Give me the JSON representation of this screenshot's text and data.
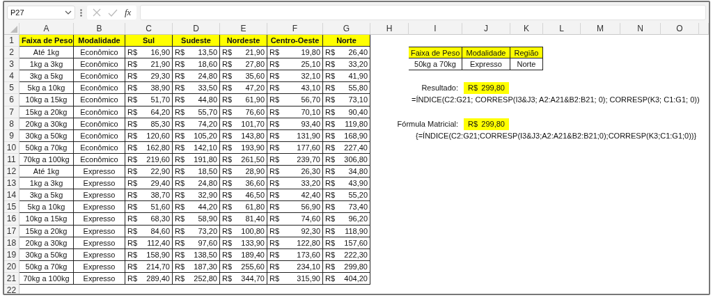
{
  "name_box": "P27",
  "formula_bar": {
    "fx_label": "fx"
  },
  "columns": [
    "A",
    "B",
    "C",
    "D",
    "E",
    "F",
    "G",
    "H",
    "I",
    "J",
    "K",
    "L",
    "M",
    "N",
    "O"
  ],
  "row_numbers": [
    "1",
    "2",
    "3",
    "4",
    "5",
    "6",
    "7",
    "8",
    "9",
    "10",
    "11",
    "12",
    "13",
    "14",
    "15",
    "16",
    "17",
    "18",
    "19",
    "20",
    "21",
    "22"
  ],
  "price_table": {
    "headers": [
      "Faixa de Peso",
      "Modalidade",
      "Sul",
      "Sudeste",
      "Nordeste",
      "Centro-Oeste",
      "Norte"
    ],
    "rows": [
      {
        "faixa": "Até 1kg",
        "modalidade": "Econômico",
        "prices": [
          {
            "currency": "R$",
            "amount": "16,90"
          },
          {
            "currency": "R$",
            "amount": "13,50"
          },
          {
            "currency": "R$",
            "amount": "21,90"
          },
          {
            "currency": "R$",
            "amount": "19,80"
          },
          {
            "currency": "R$",
            "amount": "26,40"
          }
        ]
      },
      {
        "faixa": "1kg a 3kg",
        "modalidade": "Econômico",
        "prices": [
          {
            "currency": "R$",
            "amount": "21,90"
          },
          {
            "currency": "R$",
            "amount": "18,60"
          },
          {
            "currency": "R$",
            "amount": "27,80"
          },
          {
            "currency": "R$",
            "amount": "25,10"
          },
          {
            "currency": "R$",
            "amount": "33,20"
          }
        ]
      },
      {
        "faixa": "3kg a 5kg",
        "modalidade": "Econômico",
        "prices": [
          {
            "currency": "R$",
            "amount": "29,30"
          },
          {
            "currency": "R$",
            "amount": "24,80"
          },
          {
            "currency": "R$",
            "amount": "35,60"
          },
          {
            "currency": "R$",
            "amount": "32,10"
          },
          {
            "currency": "R$",
            "amount": "41,90"
          }
        ]
      },
      {
        "faixa": "5kg a 10kg",
        "modalidade": "Econômico",
        "prices": [
          {
            "currency": "R$",
            "amount": "38,90"
          },
          {
            "currency": "R$",
            "amount": "33,50"
          },
          {
            "currency": "R$",
            "amount": "47,20"
          },
          {
            "currency": "R$",
            "amount": "43,10"
          },
          {
            "currency": "R$",
            "amount": "55,80"
          }
        ]
      },
      {
        "faixa": "10kg a 15kg",
        "modalidade": "Econômico",
        "prices": [
          {
            "currency": "R$",
            "amount": "51,70"
          },
          {
            "currency": "R$",
            "amount": "44,80"
          },
          {
            "currency": "R$",
            "amount": "61,90"
          },
          {
            "currency": "R$",
            "amount": "56,70"
          },
          {
            "currency": "R$",
            "amount": "73,10"
          }
        ]
      },
      {
        "faixa": "15kg a 20kg",
        "modalidade": "Econômico",
        "prices": [
          {
            "currency": "R$",
            "amount": "64,20"
          },
          {
            "currency": "R$",
            "amount": "55,70"
          },
          {
            "currency": "R$",
            "amount": "76,60"
          },
          {
            "currency": "R$",
            "amount": "70,10"
          },
          {
            "currency": "R$",
            "amount": "90,40"
          }
        ]
      },
      {
        "faixa": "20kg a 30kg",
        "modalidade": "Econômico",
        "prices": [
          {
            "currency": "R$",
            "amount": "85,30"
          },
          {
            "currency": "R$",
            "amount": "74,20"
          },
          {
            "currency": "R$",
            "amount": "101,70"
          },
          {
            "currency": "R$",
            "amount": "93,40"
          },
          {
            "currency": "R$",
            "amount": "119,80"
          }
        ]
      },
      {
        "faixa": "30kg a 50kg",
        "modalidade": "Econômico",
        "prices": [
          {
            "currency": "R$",
            "amount": "120,60"
          },
          {
            "currency": "R$",
            "amount": "105,20"
          },
          {
            "currency": "R$",
            "amount": "143,80"
          },
          {
            "currency": "R$",
            "amount": "131,90"
          },
          {
            "currency": "R$",
            "amount": "168,90"
          }
        ]
      },
      {
        "faixa": "50kg a 70kg",
        "modalidade": "Econômico",
        "prices": [
          {
            "currency": "R$",
            "amount": "162,80"
          },
          {
            "currency": "R$",
            "amount": "142,10"
          },
          {
            "currency": "R$",
            "amount": "193,90"
          },
          {
            "currency": "R$",
            "amount": "177,60"
          },
          {
            "currency": "R$",
            "amount": "227,40"
          }
        ]
      },
      {
        "faixa": "70kg a 100kg",
        "modalidade": "Econômico",
        "prices": [
          {
            "currency": "R$",
            "amount": "219,60"
          },
          {
            "currency": "R$",
            "amount": "191,80"
          },
          {
            "currency": "R$",
            "amount": "261,50"
          },
          {
            "currency": "R$",
            "amount": "239,70"
          },
          {
            "currency": "R$",
            "amount": "306,80"
          }
        ]
      },
      {
        "faixa": "Até 1kg",
        "modalidade": "Expresso",
        "prices": [
          {
            "currency": "R$",
            "amount": "22,90"
          },
          {
            "currency": "R$",
            "amount": "18,50"
          },
          {
            "currency": "R$",
            "amount": "28,90"
          },
          {
            "currency": "R$",
            "amount": "26,30"
          },
          {
            "currency": "R$",
            "amount": "34,80"
          }
        ]
      },
      {
        "faixa": "1kg a 3kg",
        "modalidade": "Expresso",
        "prices": [
          {
            "currency": "R$",
            "amount": "29,40"
          },
          {
            "currency": "R$",
            "amount": "24,80"
          },
          {
            "currency": "R$",
            "amount": "36,60"
          },
          {
            "currency": "R$",
            "amount": "33,20"
          },
          {
            "currency": "R$",
            "amount": "43,90"
          }
        ]
      },
      {
        "faixa": "3kg a 5kg",
        "modalidade": "Expresso",
        "prices": [
          {
            "currency": "R$",
            "amount": "38,70"
          },
          {
            "currency": "R$",
            "amount": "32,90"
          },
          {
            "currency": "R$",
            "amount": "46,50"
          },
          {
            "currency": "R$",
            "amount": "42,40"
          },
          {
            "currency": "R$",
            "amount": "55,20"
          }
        ]
      },
      {
        "faixa": "5kg a 10kg",
        "modalidade": "Expresso",
        "prices": [
          {
            "currency": "R$",
            "amount": "51,60"
          },
          {
            "currency": "R$",
            "amount": "44,20"
          },
          {
            "currency": "R$",
            "amount": "61,80"
          },
          {
            "currency": "R$",
            "amount": "56,90"
          },
          {
            "currency": "R$",
            "amount": "73,40"
          }
        ]
      },
      {
        "faixa": "10kg a 15kg",
        "modalidade": "Expresso",
        "prices": [
          {
            "currency": "R$",
            "amount": "68,30"
          },
          {
            "currency": "R$",
            "amount": "58,90"
          },
          {
            "currency": "R$",
            "amount": "81,40"
          },
          {
            "currency": "R$",
            "amount": "74,60"
          },
          {
            "currency": "R$",
            "amount": "96,20"
          }
        ]
      },
      {
        "faixa": "15kg a 20kg",
        "modalidade": "Expresso",
        "prices": [
          {
            "currency": "R$",
            "amount": "84,60"
          },
          {
            "currency": "R$",
            "amount": "73,20"
          },
          {
            "currency": "R$",
            "amount": "100,80"
          },
          {
            "currency": "R$",
            "amount": "92,30"
          },
          {
            "currency": "R$",
            "amount": "118,90"
          }
        ]
      },
      {
        "faixa": "20kg a 30kg",
        "modalidade": "Expresso",
        "prices": [
          {
            "currency": "R$",
            "amount": "112,40"
          },
          {
            "currency": "R$",
            "amount": "97,60"
          },
          {
            "currency": "R$",
            "amount": "133,90"
          },
          {
            "currency": "R$",
            "amount": "122,80"
          },
          {
            "currency": "R$",
            "amount": "157,60"
          }
        ]
      },
      {
        "faixa": "30kg a 50kg",
        "modalidade": "Expresso",
        "prices": [
          {
            "currency": "R$",
            "amount": "158,90"
          },
          {
            "currency": "R$",
            "amount": "138,50"
          },
          {
            "currency": "R$",
            "amount": "189,40"
          },
          {
            "currency": "R$",
            "amount": "173,60"
          },
          {
            "currency": "R$",
            "amount": "222,30"
          }
        ]
      },
      {
        "faixa": "50kg a 70kg",
        "modalidade": "Expresso",
        "prices": [
          {
            "currency": "R$",
            "amount": "214,70"
          },
          {
            "currency": "R$",
            "amount": "187,30"
          },
          {
            "currency": "R$",
            "amount": "255,60"
          },
          {
            "currency": "R$",
            "amount": "234,10"
          },
          {
            "currency": "R$",
            "amount": "299,80"
          }
        ]
      },
      {
        "faixa": "70kg a 100kg",
        "modalidade": "Expresso",
        "prices": [
          {
            "currency": "R$",
            "amount": "289,40"
          },
          {
            "currency": "R$",
            "amount": "252,80"
          },
          {
            "currency": "R$",
            "amount": "344,70"
          },
          {
            "currency": "R$",
            "amount": "315,90"
          },
          {
            "currency": "R$",
            "amount": "404,20"
          }
        ]
      }
    ]
  },
  "lookup_table": {
    "headers": [
      "Faixa de Peso",
      "Modalidade",
      "Região"
    ],
    "values": [
      "50kg a 70kg",
      "Expresso",
      "Norte"
    ]
  },
  "results": [
    {
      "label": "Resultado:",
      "currency": "R$",
      "amount": "299,80",
      "formula": "=ÍNDICE(C2:G21; CORRESP(I3&J3; A2:A21&B2:B21; 0); CORRESP(K3; C1:G1; 0))"
    },
    {
      "label": "Fórmula Matricial:",
      "currency": "R$",
      "amount": "299,80",
      "formula": "{=ÍNDICE(C2:G21;CORRESP(I3&J3;A2:A21&B2:B21;0);CORRESP(K3;C1:G1;0))}"
    }
  ]
}
